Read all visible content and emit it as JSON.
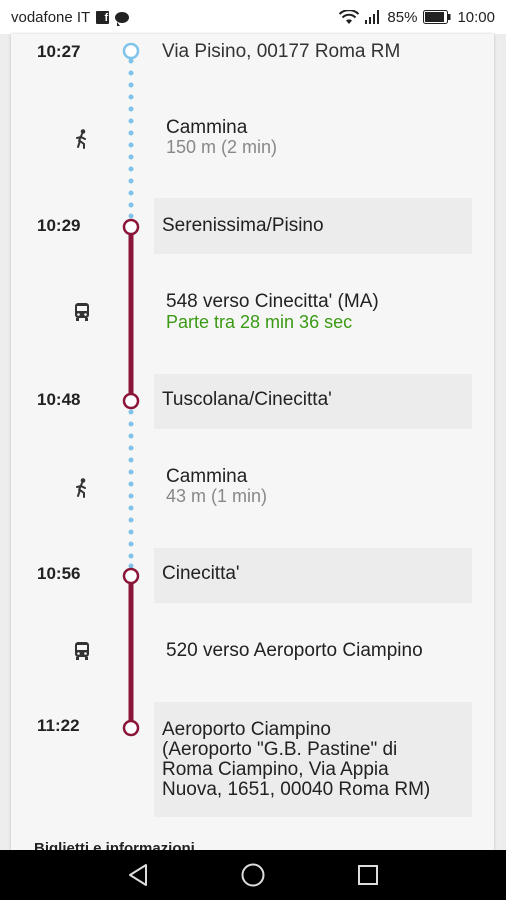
{
  "status_bar": {
    "carrier": "vodafone IT",
    "battery": "85%",
    "time": "10:00"
  },
  "itinerary": {
    "stops": [
      {
        "time": "10:27",
        "name": "Via Pisino, 00177 Roma RM"
      },
      {
        "time": "10:29",
        "name": "Serenissima/Pisino"
      },
      {
        "time": "10:48",
        "name": "Tuscolana/Cinecitta'"
      },
      {
        "time": "10:56",
        "name": "Cinecitta'"
      },
      {
        "time": "11:22",
        "name": "Aeroporto Ciampino\n(Aeroporto \"G.B. Pastine\" di\nRoma Ciampino, Via Appia\nNuova, 1651, 00040 Roma RM)"
      }
    ],
    "legs": [
      {
        "mode": "walk",
        "icon": "walk-icon",
        "title": "Cammina",
        "detail": "150 m (2 min)"
      },
      {
        "mode": "bus",
        "icon": "bus-icon",
        "title": "548 verso Cinecitta' (MA)",
        "detail": "Parte tra 28 min 36 sec"
      },
      {
        "mode": "walk",
        "icon": "walk-icon",
        "title": "Cammina",
        "detail": "43 m (1 min)"
      },
      {
        "mode": "bus",
        "icon": "bus-icon",
        "title": "520 verso Aeroporto Ciampino",
        "detail": ""
      }
    ],
    "colors": {
      "walk_dots": "#7ec3ea",
      "bus_line": "#8b1538",
      "departure_text": "#3a9a14"
    }
  },
  "footer": {
    "section_heading": "Biglietti e informazioni"
  }
}
